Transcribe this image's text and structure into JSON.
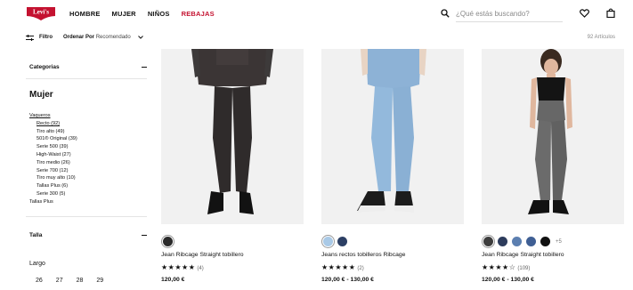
{
  "header": {
    "logo_text": "Levi's",
    "nav": [
      "HOMBRE",
      "MUJER",
      "NIÑOS",
      "REBAJAS"
    ],
    "search_placeholder": "¿Qué estás buscando?",
    "brand_color": "#c41230"
  },
  "toolbar": {
    "filter_label": "Filtro",
    "sort_label": "Ordenar Por",
    "sort_value": "Recomendado",
    "count": "92 Artículos"
  },
  "sidebar": {
    "categories_title": "Categorias",
    "section_title": "Mujer",
    "parent": "Vaqueros",
    "children": [
      "Recto (92)",
      "Tiro alto (49)",
      "501® Original (39)",
      "Serie 500 (39)",
      "High-Waist (27)",
      "Tiro medio (26)",
      "Serie 700 (12)",
      "Tiro muy alto (10)",
      "Tallas Plus (6)",
      "Serie 300 (5)"
    ],
    "extra": "Tallas Plus",
    "size_title": "Talla",
    "length_label": "Largo",
    "sizes": [
      "26",
      "27",
      "28",
      "29"
    ]
  },
  "products": [
    {
      "name": "Jean Ribcage Straight tobillero",
      "stars": "★★★★★",
      "reviews": "(4)",
      "price": "120,00 €",
      "swatches": [
        "#2a2a2a"
      ],
      "more": ""
    },
    {
      "name": "Jeans rectos tobilleros Ribcage",
      "stars": "★★★★★",
      "reviews": "(2)",
      "price": "120,00 € - 130,00 €",
      "swatches": [
        "#a9c9e6",
        "#2c3f64"
      ],
      "more": ""
    },
    {
      "name": "Jean Ribcage Straight tobillero",
      "stars": "★★★★☆",
      "reviews": "(109)",
      "price": "120,00 € - 130,00 €",
      "swatches": [
        "#3d3d3d",
        "#2d3c5c",
        "#5c7fb0",
        "#3f5f94",
        "#111111"
      ],
      "more": "+5"
    }
  ]
}
